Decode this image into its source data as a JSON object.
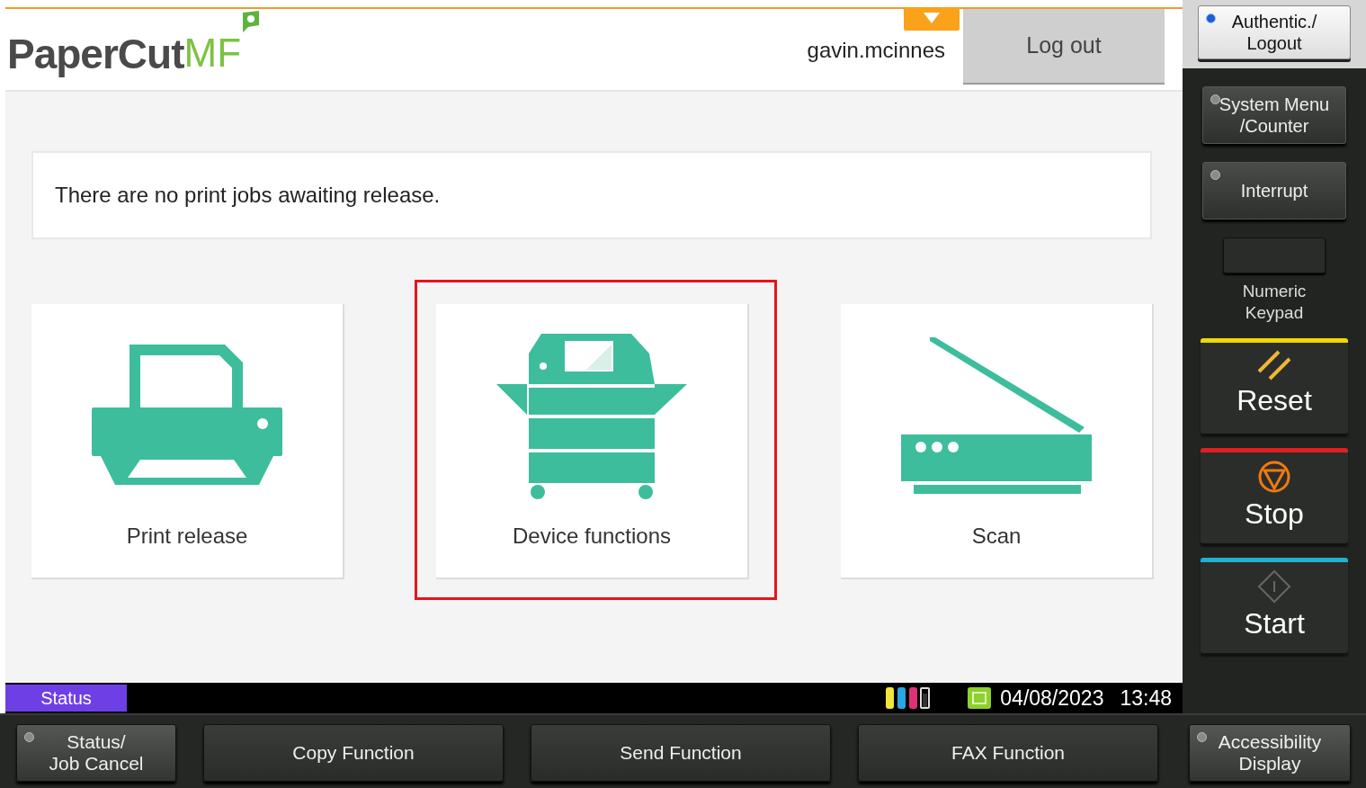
{
  "header": {
    "logo_main": "PaperCut",
    "logo_suffix": "MF",
    "username": "gavin.mcinnes",
    "logout": "Log out"
  },
  "message": "There are no print jobs awaiting release.",
  "tiles": [
    {
      "kind": "printer",
      "label": "Print release"
    },
    {
      "kind": "copier",
      "label": "Device functions",
      "highlighted": true
    },
    {
      "kind": "scanner",
      "label": "Scan"
    }
  ],
  "status_bar": {
    "tab": "Status",
    "date": "04/08/2023",
    "time": "13:48"
  },
  "side_keys": [
    {
      "kind": "led",
      "label": "Authentic./ Logout",
      "led_on": true
    },
    {
      "kind": "led",
      "label": "System Menu /Counter",
      "led_on": false
    },
    {
      "kind": "led",
      "label": "Interrupt",
      "led_on": false
    },
    {
      "kind": "pad",
      "label": "Numeric Keypad"
    },
    {
      "kind": "reset",
      "label": "Reset",
      "color": "#f0d800"
    },
    {
      "kind": "stop",
      "label": "Stop",
      "color": "#e02020"
    },
    {
      "kind": "start",
      "label": "Start",
      "color": "#20b0d0"
    }
  ],
  "bottom_keys": [
    {
      "kind": "led",
      "label": "Status/\nJob Cancel",
      "led_on": false
    },
    {
      "kind": "wide",
      "label": "Copy Function"
    },
    {
      "kind": "wide",
      "label": "Send Function"
    },
    {
      "kind": "wide",
      "label": "FAX Function"
    },
    {
      "kind": "led",
      "label": "Accessibility Display",
      "led_on": false
    }
  ]
}
